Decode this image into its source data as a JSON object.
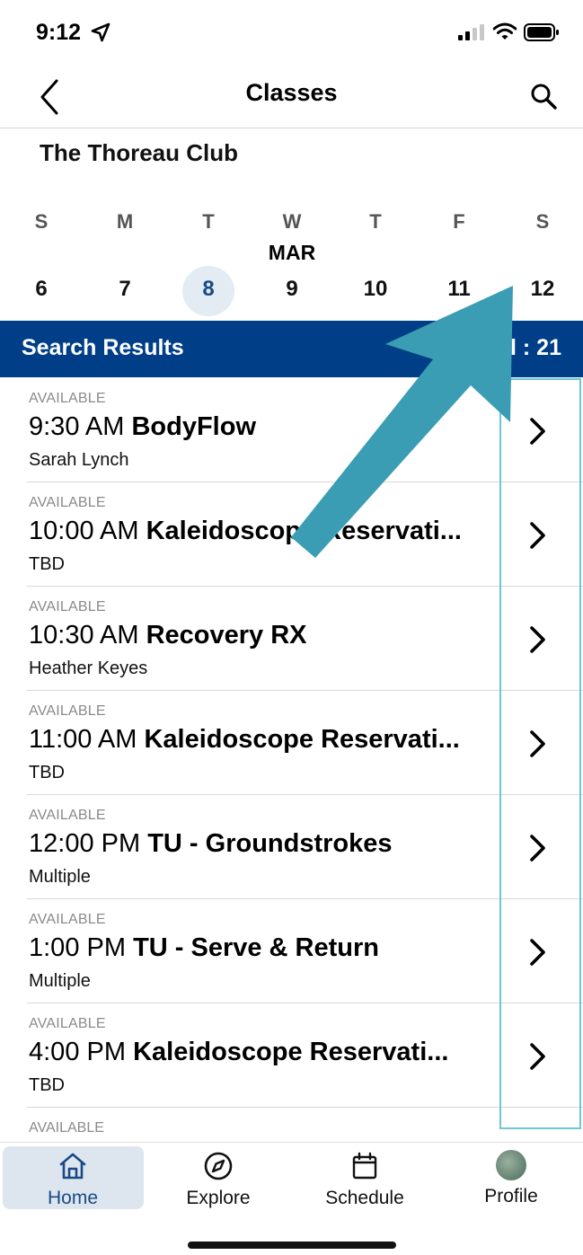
{
  "status": {
    "time": "9:12"
  },
  "nav": {
    "title": "Classes"
  },
  "club": {
    "name": "The Thoreau Club"
  },
  "calendar": {
    "month": "MAR",
    "days": [
      {
        "letter": "S",
        "num": "6"
      },
      {
        "letter": "M",
        "num": "7"
      },
      {
        "letter": "T",
        "num": "8"
      },
      {
        "letter": "W",
        "num": "9"
      },
      {
        "letter": "T",
        "num": "10"
      },
      {
        "letter": "F",
        "num": "11"
      },
      {
        "letter": "S",
        "num": "12"
      }
    ],
    "selected": "8"
  },
  "results": {
    "title": "Search Results",
    "total": "l : 21"
  },
  "classes": [
    {
      "status": "AVAILABLE",
      "time": "9:30 AM",
      "name": "BodyFlow",
      "instructor": "Sarah Lynch"
    },
    {
      "status": "AVAILABLE",
      "time": "10:00 AM",
      "name": "Kaleidoscope Reservati...",
      "instructor": "TBD"
    },
    {
      "status": "AVAILABLE",
      "time": "10:30 AM",
      "name": "Recovery RX",
      "instructor": "Heather Keyes"
    },
    {
      "status": "AVAILABLE",
      "time": "11:00 AM",
      "name": "Kaleidoscope Reservati...",
      "instructor": "TBD"
    },
    {
      "status": "AVAILABLE",
      "time": "12:00 PM",
      "name": "TU - Groundstrokes",
      "instructor": "Multiple"
    },
    {
      "status": "AVAILABLE",
      "time": "1:00 PM",
      "name": "TU - Serve & Return",
      "instructor": "Multiple"
    },
    {
      "status": "AVAILABLE",
      "time": "4:00 PM",
      "name": "Kaleidoscope Reservati...",
      "instructor": "TBD"
    }
  ],
  "partial_row": {
    "status": "AVAILABLE"
  },
  "tabs": [
    {
      "label": "Home",
      "icon": "home-icon"
    },
    {
      "label": "Explore",
      "icon": "compass-icon"
    },
    {
      "label": "Schedule",
      "icon": "calendar-icon"
    },
    {
      "label": "Profile",
      "icon": "avatar"
    }
  ],
  "colors": {
    "brand": "#003f88",
    "annotation": "#3a9db3",
    "selected_day_bg": "#e3ebf3"
  }
}
